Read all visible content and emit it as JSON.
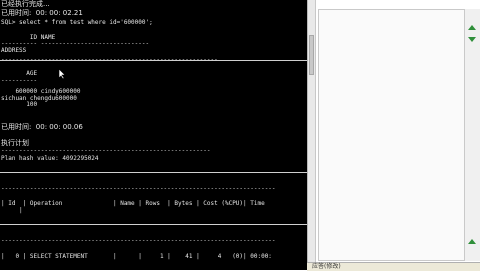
{
  "console": {
    "lines": [
      "已经执行完成...",
      "已用时间:  00: 00: 02.21",
      "SQL> select * from test where id='600000';",
      "",
      "        ID NAME",
      "---------- ------------------------------",
      "ADDRESS",
      "------------------------------------------------------------",
      "       AGE",
      "----------",
      "    600000 cindy600000",
      "sichuan chengdu600000",
      "       100",
      "",
      "已用时间:  00: 00: 00.06",
      "",
      "执行计划",
      "----------------------------------------------------------",
      "Plan hash value: 4092295024",
      "",
      "----------------------------------------------------------------------------",
      "",
      "| Id  | Operation              | Name | Rows  | Bytes | Cost (%CPU)| Time",
      "     |",
      "",
      "----------------------------------------------------------------------------",
      "",
      "|   0 | SELECT STATEMENT       |      |     1 |    41 |     4   (0)| 00:00:",
      ""
    ]
  },
  "side_panel": {
    "status_text": "应答(修改)"
  }
}
